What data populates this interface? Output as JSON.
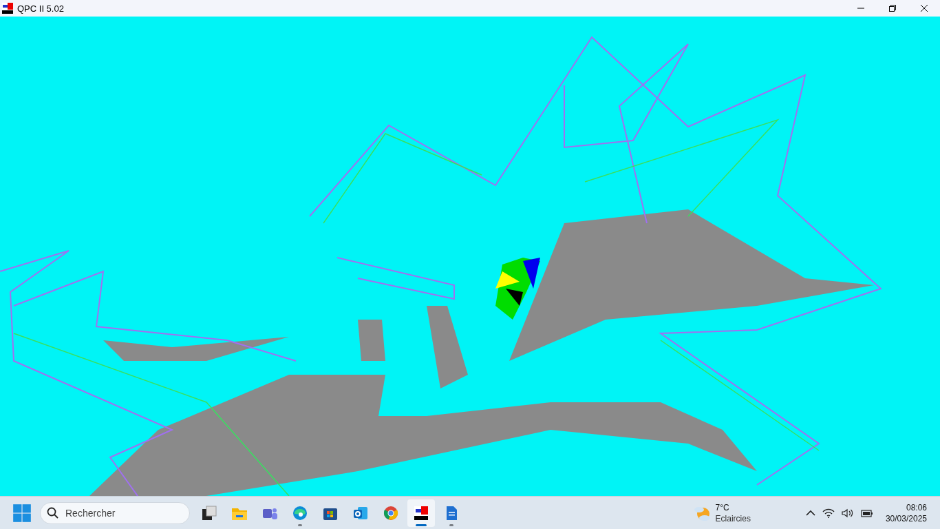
{
  "window": {
    "title": "QPC II 5.02"
  },
  "taskbar": {
    "search": {
      "placeholder": "Rechercher"
    },
    "apps": [
      {
        "kind": "taskview",
        "running": false,
        "selected": false
      },
      {
        "kind": "folder",
        "running": false,
        "selected": false
      },
      {
        "kind": "teams",
        "running": false,
        "selected": false
      },
      {
        "kind": "edge",
        "running": true,
        "selected": false
      },
      {
        "kind": "store",
        "running": false,
        "selected": false
      },
      {
        "kind": "outlook",
        "running": false,
        "selected": false
      },
      {
        "kind": "chrome",
        "running": false,
        "selected": false
      },
      {
        "kind": "qpc",
        "running": true,
        "selected": true
      },
      {
        "kind": "writer",
        "running": true,
        "selected": false
      }
    ],
    "weather": {
      "temperature": "7°C",
      "condition": "Eclaircies"
    },
    "clock": {
      "time": "08:06",
      "date": "30/03/2025"
    }
  }
}
